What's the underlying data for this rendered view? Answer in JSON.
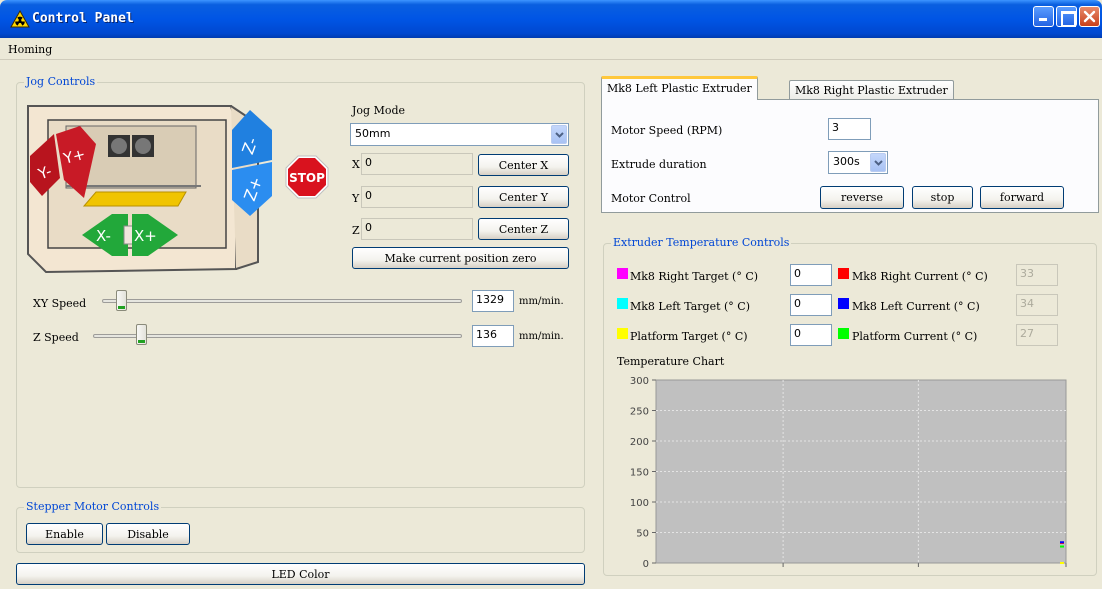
{
  "window": {
    "title": "Control Panel"
  },
  "menu": {
    "items": [
      {
        "label": "Homing"
      }
    ]
  },
  "jog": {
    "legend": "Jog Controls",
    "mode_label": "Jog Mode",
    "mode_value": "50mm",
    "axes": [
      {
        "label": "X",
        "value": "0",
        "button": "Center X"
      },
      {
        "label": "Y",
        "value": "0",
        "button": "Center Y"
      },
      {
        "label": "Z",
        "value": "0",
        "button": "Center Z"
      }
    ],
    "zero_button": "Make current position zero",
    "xy_speed": {
      "label": "XY Speed",
      "value": "1329",
      "unit": "mm/min.",
      "slider_fraction": 0.04
    },
    "z_speed": {
      "label": "Z Speed",
      "value": "136",
      "unit": "mm/min.",
      "slider_fraction": 0.12
    },
    "diagram": {
      "y_minus": "Y-",
      "y_plus": "Y+",
      "z_minus": "Z-",
      "z_plus": "Z+",
      "x_minus": "X-",
      "x_plus": "X+",
      "stop": "STOP"
    }
  },
  "stepper": {
    "legend": "Stepper Motor Controls",
    "enable": "Enable",
    "disable": "Disable"
  },
  "led_button": "LED Color",
  "tabs": [
    {
      "label": "Mk8 Left Plastic Extruder",
      "active": true
    },
    {
      "label": "Mk8 Right Plastic Extruder",
      "active": false
    }
  ],
  "extruder": {
    "motor_speed_label": "Motor Speed (RPM)",
    "motor_speed_value": "3",
    "duration_label": "Extrude duration",
    "duration_value": "300s",
    "motor_control_label": "Motor Control",
    "reverse": "reverse",
    "stop": "stop",
    "forward": "forward"
  },
  "temps": {
    "legend": "Extruder Temperature Controls",
    "rows": [
      {
        "target_label": "Mk8 Right Target (° C)",
        "target_value": "0",
        "target_color": "#ff00ff",
        "current_label": "Mk8 Right Current (° C)",
        "current_value": "33",
        "current_color": "#ff0000"
      },
      {
        "target_label": "Mk8 Left Target (° C)",
        "target_value": "0",
        "target_color": "#00ffff",
        "current_label": "Mk8 Left Current (° C)",
        "current_value": "34",
        "current_color": "#0000ff"
      },
      {
        "target_label": "Platform Target (° C)",
        "target_value": "0",
        "target_color": "#ffff00",
        "current_label": "Platform Current (° C)",
        "current_value": "27",
        "current_color": "#00ff00"
      }
    ],
    "chart_title": "Temperature Chart",
    "chart_y_ticks": [
      "300",
      "250",
      "200",
      "150",
      "100",
      "50",
      "0"
    ]
  },
  "chart_data": {
    "type": "line",
    "title": "Temperature Chart",
    "ylim": [
      0,
      300
    ],
    "y_ticks": [
      0,
      50,
      100,
      150,
      200,
      250,
      300
    ],
    "grid": true,
    "series": [
      {
        "name": "Mk8 Right Current",
        "color": "#ff0000",
        "values": [
          33
        ]
      },
      {
        "name": "Mk8 Left Current",
        "color": "#0000ff",
        "values": [
          34
        ]
      },
      {
        "name": "Platform Current",
        "color": "#00ff00",
        "values": [
          27
        ]
      },
      {
        "name": "Mk8 Right Target",
        "color": "#ff00ff",
        "values": [
          0
        ]
      },
      {
        "name": "Mk8 Left Target",
        "color": "#00ffff",
        "values": [
          0
        ]
      },
      {
        "name": "Platform Target",
        "color": "#ffff00",
        "values": [
          0
        ]
      }
    ]
  }
}
